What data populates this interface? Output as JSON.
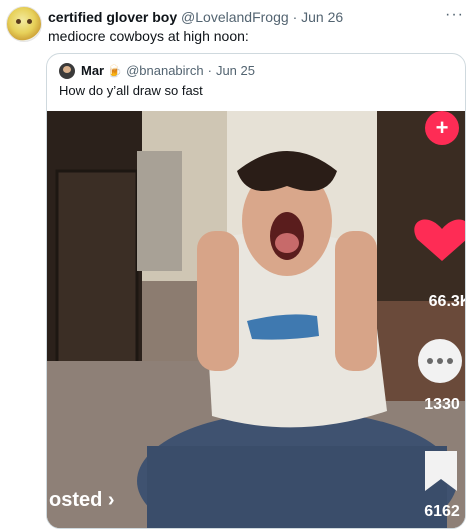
{
  "tweet": {
    "author_name": "certified glover boy",
    "handle": "@LovelandFrogg",
    "separator": "·",
    "date": "Jun 26",
    "text": "mediocre cowboys at high noon:",
    "more_label": "···"
  },
  "quoted": {
    "author_name": "Mar",
    "badge_icon": "beer-mug-icon",
    "handle": "@bnanabirch",
    "separator": "·",
    "date": "Jun 25",
    "text": "How do y’all draw so fast"
  },
  "video_overlay": {
    "likes": "66.3K",
    "comments": "1330",
    "saves": "6162",
    "posted_label": "osted ›",
    "accent_color": "#fe2c55"
  }
}
